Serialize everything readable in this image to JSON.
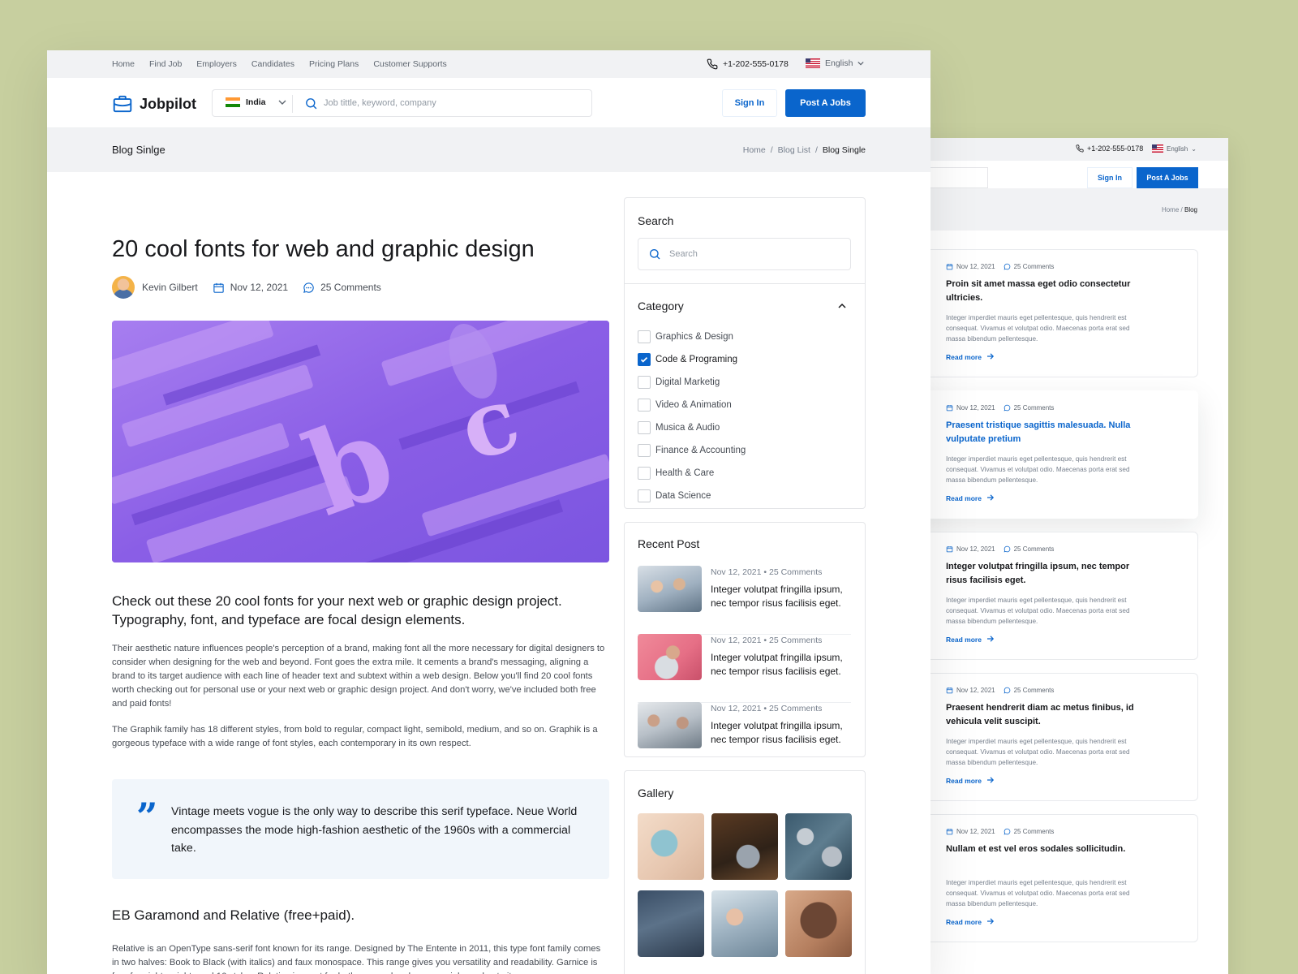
{
  "topbar": {
    "nav": [
      "Home",
      "Find Job",
      "Employers",
      "Candidates",
      "Pricing Plans",
      "Customer Supports"
    ],
    "phone": "+1-202-555-0178",
    "language": "English"
  },
  "header": {
    "logo": "Jobpilot",
    "country": "India",
    "search_placeholder": "Job tittle, keyword, company",
    "sign_in": "Sign In",
    "post_job": "Post A Jobs"
  },
  "breadcrumb": {
    "page_title": "Blog Sinlge",
    "trail": [
      "Home",
      "Blog List",
      "Blog Single"
    ],
    "sep": "/"
  },
  "article": {
    "title": "20 cool fonts for web and graphic design",
    "author": "Kevin Gilbert",
    "date": "Nov 12, 2021",
    "comments": "25 Comments",
    "lead": "Check out these 20 cool fonts for your next web or graphic design project. Typography, font, and typeface are focal design elements.",
    "p1": "Their aesthetic nature influences people's perception of a brand, making font all the more necessary for digital designers to consider when designing for the web and beyond. Font goes the extra mile. It cements a brand's messaging, aligning a brand to its target audience with each line of header text and subtext within a web design. Below you'll find 20 cool fonts worth checking out for personal use or your next web or graphic design project. And don't worry, we've included both free and paid fonts!",
    "p2": "The Graphik family has 18 different styles, from bold to regular, compact light, semibold, medium, and so on. Graphik is a gorgeous typeface with a wide range of font styles, each contemporary in its own respect.",
    "quote": "Vintage meets vogue is the only way to describe this serif typeface. Neue World encompasses the mode high-fashion aesthetic of the 1960s with a commercial take.",
    "h3": "EB Garamond and Relative (free+paid).",
    "p3": "Relative is an OpenType sans-serif font known for its range. Designed by The Entente in 2011, this type font family comes in two halves: Book to Black (with italics) and faux monospace. This range gives you versatility and readability. Garnice is free for eight weights and 16 styles. Relative is great for both personal and commercial use due to its"
  },
  "sidebar": {
    "search_title": "Search",
    "search_placeholder": "Search",
    "category_title": "Category",
    "categories": [
      {
        "label": "Graphics & Design",
        "checked": false
      },
      {
        "label": "Code & Programing",
        "checked": true
      },
      {
        "label": "Digital Marketig",
        "checked": false
      },
      {
        "label": "Video & Animation",
        "checked": false
      },
      {
        "label": "Musica & Audio",
        "checked": false
      },
      {
        "label": "Finance & Accounting",
        "checked": false
      },
      {
        "label": "Health & Care",
        "checked": false
      },
      {
        "label": "Data Science",
        "checked": false
      }
    ],
    "recent_title": "Recent Post",
    "recent": [
      {
        "date": "Nov 12, 2021",
        "dot": "•",
        "comments": "25 Comments",
        "title": "Integer volutpat fringilla ipsum, nec tempor risus facilisis eget."
      },
      {
        "date": "Nov 12, 2021",
        "dot": "•",
        "comments": "25 Comments",
        "title": "Integer volutpat fringilla ipsum, nec tempor risus facilisis eget."
      },
      {
        "date": "Nov 12, 2021",
        "dot": "•",
        "comments": "25 Comments",
        "title": "Integer volutpat fringilla ipsum, nec tempor risus facilisis eget."
      }
    ],
    "gallery_title": "Gallery"
  },
  "back": {
    "phone": "+1-202-555-0178",
    "language": "English",
    "sign_in": "Sign In",
    "post_job": "Post A Jobs",
    "trail": [
      "Home",
      "Blog"
    ],
    "sep": "/",
    "cards": [
      {
        "date": "Nov 12, 2021",
        "comments": "25 Comments",
        "title": "Proin sit amet massa eget odio consectetur ultricies.",
        "desc": "Integer imperdiet mauris eget pellentesque, quis hendrerit est consequat. Vivamus et volutpat odio. Maecenas porta erat sed massa bibendum pellentesque.",
        "read": "Read more"
      },
      {
        "date": "Nov 12, 2021",
        "comments": "25 Comments",
        "title": "Praesent tristique sagittis malesuada. Nulla vulputate pretium",
        "desc": "Integer imperdiet mauris eget pellentesque, quis hendrerit est consequat. Vivamus et volutpat odio. Maecenas porta erat sed massa bibendum pellentesque.",
        "read": "Read more"
      },
      {
        "date": "Nov 12, 2021",
        "comments": "25 Comments",
        "title": "Integer volutpat fringilla ipsum, nec tempor risus facilisis eget.",
        "desc": "Integer imperdiet mauris eget pellentesque, quis hendrerit est consequat. Vivamus et volutpat odio. Maecenas porta erat sed massa bibendum pellentesque.",
        "read": "Read more"
      },
      {
        "date": "Nov 12, 2021",
        "comments": "25 Comments",
        "title": "Praesent hendrerit diam ac metus finibus, id vehicula velit suscipit.",
        "desc": "Integer imperdiet mauris eget pellentesque, quis hendrerit est consequat. Vivamus et volutpat odio. Maecenas porta erat sed massa bibendum pellentesque.",
        "read": "Read more"
      },
      {
        "date": "Nov 12, 2021",
        "comments": "25 Comments",
        "title": "Nullam et est vel eros sodales sollicitudin.",
        "desc": "Integer imperdiet mauris eget pellentesque, quis hendrerit est consequat. Vivamus et volutpat odio. Maecenas porta erat sed massa bibendum pellentesque.",
        "read": "Read more"
      }
    ]
  },
  "colors": {
    "accent": "#0a65cc",
    "background": "#c7cf9f",
    "quote_bg": "#f1f6fb"
  }
}
